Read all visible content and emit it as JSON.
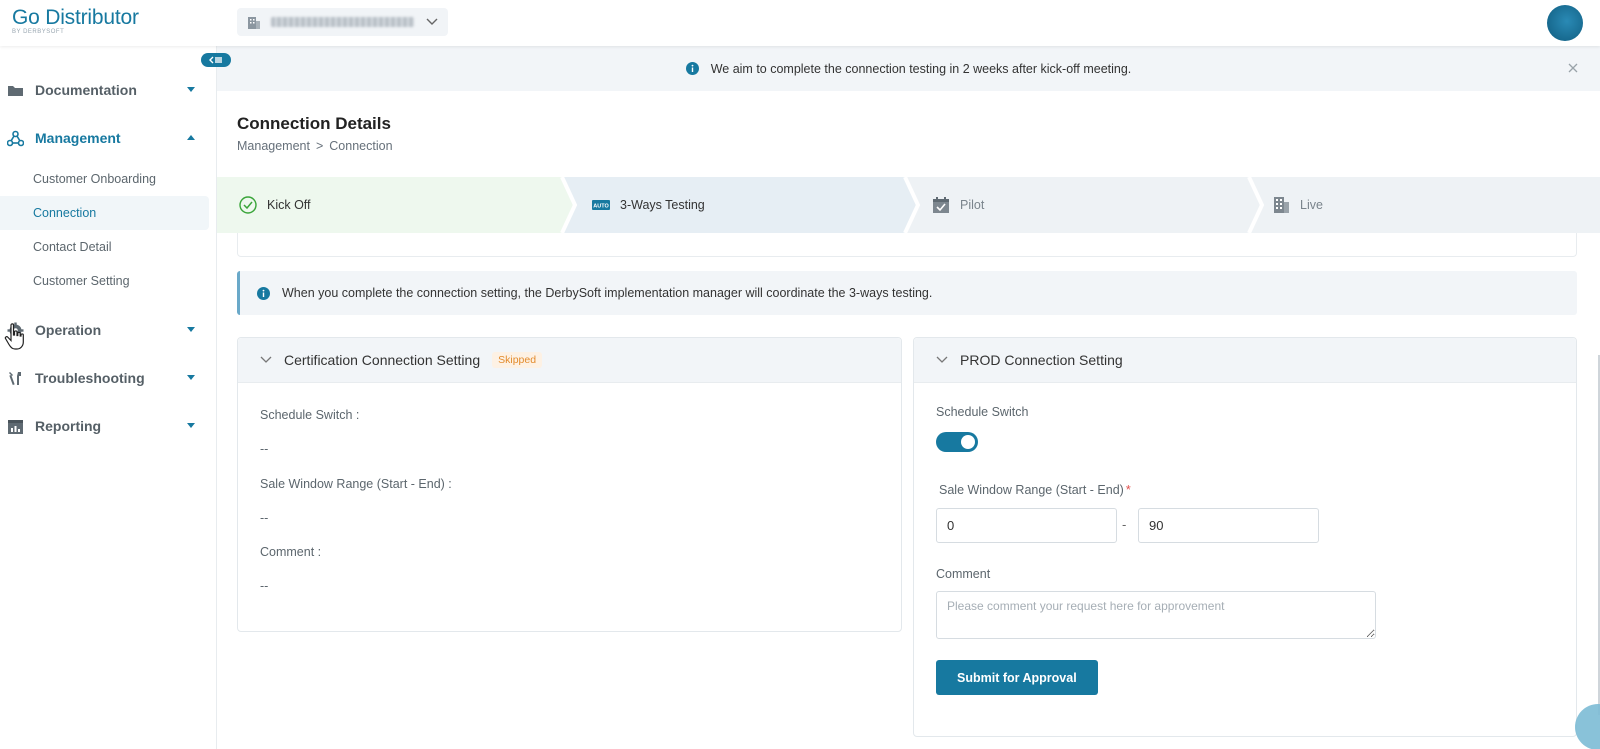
{
  "app": {
    "logo_title": "Go Distributor",
    "logo_subtitle": "BY DERBYSOFT"
  },
  "sidebar": {
    "groups": [
      {
        "label": "Documentation",
        "icon": "folder-icon",
        "expanded": false
      },
      {
        "label": "Management",
        "icon": "network-icon",
        "expanded": true
      },
      {
        "label": "Operation",
        "icon": "gear-icon",
        "expanded": false
      },
      {
        "label": "Troubleshooting",
        "icon": "tools-icon",
        "expanded": false
      },
      {
        "label": "Reporting",
        "icon": "report-icon",
        "expanded": false
      }
    ],
    "management_items": [
      {
        "label": "Customer Onboarding",
        "active": false
      },
      {
        "label": "Connection",
        "active": true
      },
      {
        "label": "Contact Detail",
        "active": false
      },
      {
        "label": "Customer Setting",
        "active": false
      }
    ]
  },
  "banner": {
    "text": "We aim to complete the connection testing in 2 weeks after kick-off meeting."
  },
  "page": {
    "title": "Connection Details",
    "breadcrumb": [
      "Management",
      ">",
      "Connection"
    ]
  },
  "steps": [
    {
      "label": "Kick Off",
      "status": "done",
      "icon": "check-circle-icon"
    },
    {
      "label": "3-Ways Testing",
      "status": "current",
      "icon": "auto-icon"
    },
    {
      "label": "Pilot",
      "status": "pending",
      "icon": "calendar-check-icon"
    },
    {
      "label": "Live",
      "status": "pending",
      "icon": "building-icon"
    }
  ],
  "tip": {
    "text": "When you complete the connection setting, the DerbySoft implementation manager will coordinate the 3-ways testing."
  },
  "cert": {
    "title": "Certification Connection Setting",
    "badge": "Skipped",
    "schedule_label": "Schedule Switch :",
    "schedule_value": "--",
    "range_label": "Sale Window Range (Start - End) :",
    "range_value": "--",
    "comment_label": "Comment :",
    "comment_value": "--"
  },
  "prod": {
    "title": "PROD Connection Setting",
    "schedule_label": "Schedule Switch",
    "schedule_on": true,
    "range_label": "Sale Window Range (Start - End)",
    "range_required": "*",
    "range_start": "0",
    "range_sep": "-",
    "range_end": "90",
    "comment_label": "Comment",
    "comment_placeholder": "Please comment your request here for approvement",
    "submit_label": "Submit for Approval"
  },
  "colors": {
    "accent": "#1779a0",
    "done_step_bg": "#eef8ee",
    "done_check": "#3aa53a",
    "badge_text": "#e38b2c"
  }
}
